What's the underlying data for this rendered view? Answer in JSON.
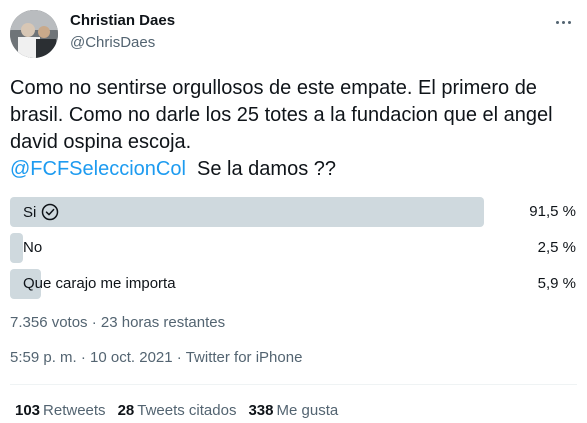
{
  "author": {
    "name": "Christian Daes",
    "handle": "@ChrisDaes"
  },
  "tweet": {
    "text_part1": "Como no sentirse orgullosos de este empate.  El primero de brasil.   Como no darle los 25 totes a la fundacion que el angel david ospina escoja.",
    "mention": "@FCFSeleccionCol",
    "text_part2": "  Se la damos ??"
  },
  "poll": {
    "options": [
      {
        "label": "Si",
        "percent_text": "91,5 %",
        "percent": 91.5,
        "winner": true
      },
      {
        "label": "No",
        "percent_text": "2,5 %",
        "percent": 2.5,
        "winner": false
      },
      {
        "label": "Que carajo me importa",
        "percent_text": "5,9 %",
        "percent": 5.9,
        "winner": false
      }
    ],
    "summary": "7.356 votos · 23 horas restantes"
  },
  "timestamp": {
    "time": "5:59 p. m.",
    "date": "10 oct. 2021",
    "separator": "·",
    "source": "Twitter for iPhone"
  },
  "stats": {
    "retweets_count": "103",
    "retweets_label": "Retweets",
    "quotes_count": "28",
    "quotes_label": "Tweets citados",
    "likes_count": "338",
    "likes_label": "Me gusta"
  },
  "colors": {
    "accent": "#1d9bf0",
    "poll_bar": "#cfd9de",
    "secondary_text": "#536471"
  },
  "icons": [
    "more-icon",
    "check-circle-icon"
  ]
}
